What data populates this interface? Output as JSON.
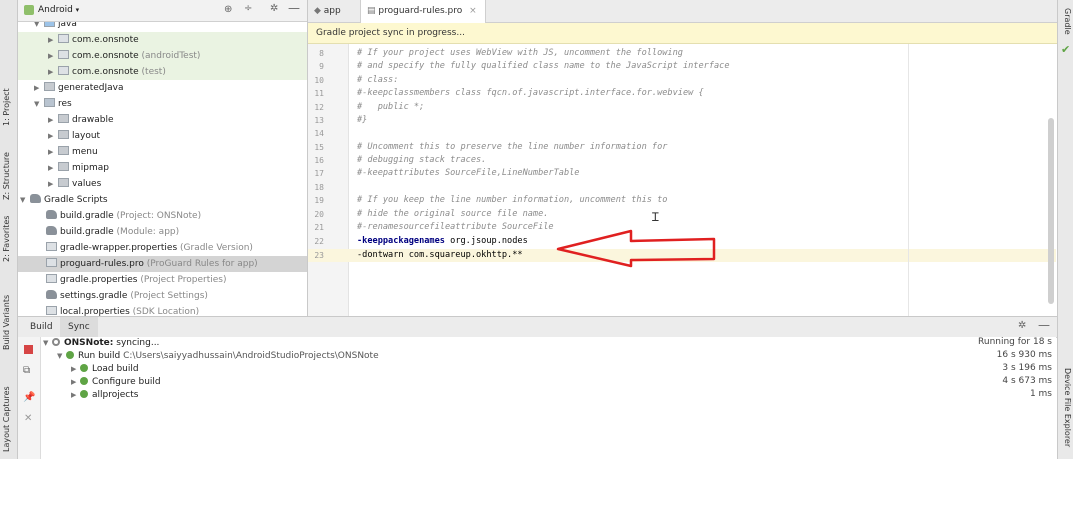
{
  "left_strip": {
    "tabs": [
      "1: Project",
      "Z: Structure",
      "2: Favorites",
      "Build Variants",
      "Layout Captures"
    ]
  },
  "right_strip": {
    "tabs": [
      "Gradle",
      "Device File Explorer"
    ]
  },
  "project_panel": {
    "view_selector": "Android",
    "tree": [
      {
        "label": "java",
        "hint": ""
      },
      {
        "label": "com.e.onsnote",
        "hint": ""
      },
      {
        "label": "com.e.onsnote",
        "hint": "(androidTest)"
      },
      {
        "label": "com.e.onsnote",
        "hint": "(test)"
      },
      {
        "label": "generatedJava",
        "hint": ""
      },
      {
        "label": "res",
        "hint": ""
      },
      {
        "label": "drawable",
        "hint": ""
      },
      {
        "label": "layout",
        "hint": ""
      },
      {
        "label": "menu",
        "hint": ""
      },
      {
        "label": "mipmap",
        "hint": ""
      },
      {
        "label": "values",
        "hint": ""
      },
      {
        "label": "Gradle Scripts",
        "hint": ""
      },
      {
        "label": "build.gradle",
        "hint": "(Project: ONSNote)"
      },
      {
        "label": "build.gradle",
        "hint": "(Module: app)"
      },
      {
        "label": "gradle-wrapper.properties",
        "hint": "(Gradle Version)"
      },
      {
        "label": "proguard-rules.pro",
        "hint": "(ProGuard Rules for app)"
      },
      {
        "label": "gradle.properties",
        "hint": "(Project Properties)"
      },
      {
        "label": "settings.gradle",
        "hint": "(Project Settings)"
      },
      {
        "label": "local.properties",
        "hint": "(SDK Location)"
      }
    ]
  },
  "editor": {
    "tabs": [
      {
        "label": "app"
      },
      {
        "label": "proguard-rules.pro",
        "close": "×"
      }
    ],
    "sync_banner": "Gradle project sync in progress...",
    "lines": [
      {
        "n": "8",
        "text": "# If your project uses WebView with JS, uncomment the following"
      },
      {
        "n": "9",
        "text": "# and specify the fully qualified class name to the JavaScript interface"
      },
      {
        "n": "10",
        "text": "# class:"
      },
      {
        "n": "11",
        "text": "#-keepclassmembers class fqcn.of.javascript.interface.for.webview {"
      },
      {
        "n": "12",
        "text": "#   public *;"
      },
      {
        "n": "13",
        "text": "#}"
      },
      {
        "n": "14",
        "text": ""
      },
      {
        "n": "15",
        "text": "# Uncomment this to preserve the line number information for"
      },
      {
        "n": "16",
        "text": "# debugging stack traces."
      },
      {
        "n": "17",
        "text": "#-keepattributes SourceFile,LineNumberTable"
      },
      {
        "n": "18",
        "text": ""
      },
      {
        "n": "19",
        "text": "# If you keep the line number information, uncomment this to"
      },
      {
        "n": "20",
        "text": "# hide the original source file name."
      },
      {
        "n": "21",
        "text": "#-renamesourcefileattribute SourceFile"
      }
    ],
    "line22": {
      "n": "22",
      "keyword": "-keeppackagenames",
      "rest": " org.jsoup.nodes"
    },
    "line23": {
      "n": "23",
      "text": "-dontwarn com.squareup.okhttp.**"
    }
  },
  "bottom_panel": {
    "tabs": [
      "Build",
      "Sync"
    ],
    "rows": [
      {
        "label": "ONSNote:",
        "suffix": " syncing...",
        "time": "Running for 18 s"
      },
      {
        "label": "Run build",
        "suffix": "  C:\\Users\\saiyyadhussain\\AndroidStudioProjects\\ONSNote",
        "time": "16 s 930 ms"
      },
      {
        "label": "Load build",
        "suffix": "",
        "time": "3 s 196 ms"
      },
      {
        "label": "Configure build",
        "suffix": "",
        "time": "4 s 673 ms"
      },
      {
        "label": "allprojects",
        "suffix": "",
        "time": "1 ms"
      }
    ]
  },
  "colors": {
    "annotation_arrow": "#e02020",
    "highlight_row": "#eaf3e2",
    "sync_banner": "#fdf8d0"
  }
}
